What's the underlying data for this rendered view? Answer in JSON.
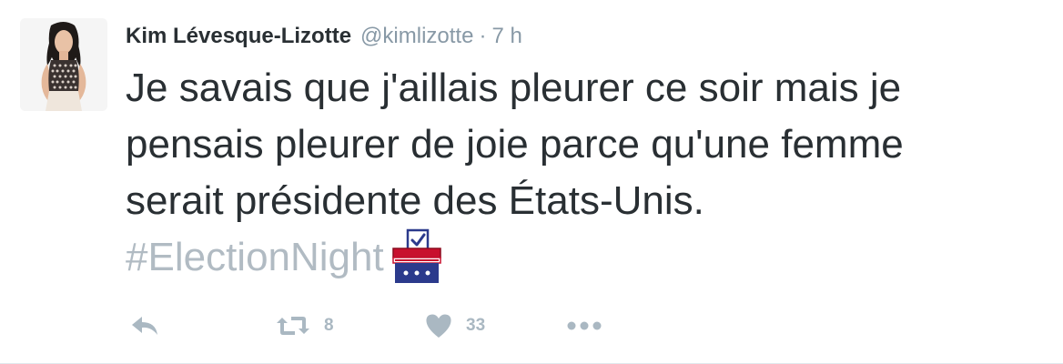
{
  "tweet": {
    "author_name": "Kim Lévesque-Lizotte",
    "author_handle": "@kimlizotte",
    "separator": "·",
    "time": "7 h",
    "text_lines": [
      "Je savais que j'aillais pleurer ce soir mais je",
      "pensais pleurer de joie parce qu'une femme",
      "serait présidente des États-Unis."
    ],
    "hashtag": "#ElectionNight",
    "emoji_icon": "ballot-box-icon"
  },
  "actions": {
    "reply_icon": "reply-icon",
    "retweet_icon": "retweet-icon",
    "retweet_count": "8",
    "like_icon": "heart-icon",
    "like_count": "33",
    "more_icon": "more-icon"
  },
  "colors": {
    "text": "#292f33",
    "muted": "#8899a6",
    "hashtag": "#b1bbc3",
    "action_icon": "#aab8c2",
    "ballot_red": "#c8102e",
    "ballot_blue": "#2b3a8c"
  }
}
